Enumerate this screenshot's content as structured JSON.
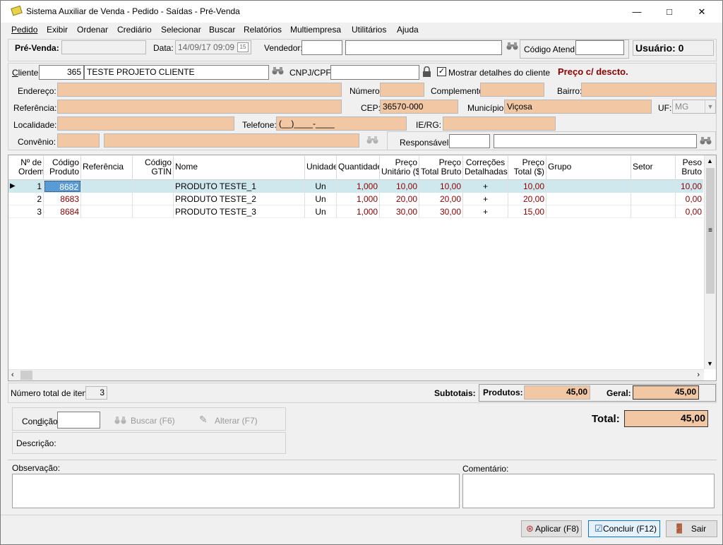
{
  "window": {
    "title": "Sistema Auxiliar de Venda - Pedido - Saídas - Pré-Venda",
    "minimize": "—",
    "maximize": "□",
    "close": "✕"
  },
  "menu": [
    "Pedido",
    "Exibir",
    "Ordenar",
    "Crediário",
    "Selecionar",
    "Buscar",
    "Relatórios",
    "Multiempresa",
    "Utilitários",
    "Ajuda"
  ],
  "header": {
    "prevenda_label": "Pré-Venda:",
    "prevenda_value": "",
    "data_label": "Data:",
    "data_value": "14/09/17 09:09",
    "vendedor_label": "Vendedor:",
    "vendedor_code": "",
    "vendedor_name": "",
    "codigo_atend_label": "Código Atend.:",
    "codigo_atend_value": "",
    "usuario": "Usuário: 0"
  },
  "cliente": {
    "label": "Cliente:",
    "code": "365",
    "name": "TESTE PROJETO CLIENTE",
    "cnpj_label": "CNPJ/CPF:",
    "cnpj_value": "",
    "mostrar_label": "Mostrar detalhes do cliente",
    "mostrar_checked": true,
    "preco_label": "Preço c/ descto.",
    "endereco_label": "Endereço:",
    "endereco": "",
    "numero_label": "Número:",
    "numero": "",
    "complemento_label": "Complemento:",
    "complemento": "",
    "bairro_label": "Bairro:",
    "bairro": "",
    "referencia_label": "Referência:",
    "referencia": "",
    "cep_label": "CEP:",
    "cep": "36570-000",
    "municipio_label": "Município:",
    "municipio": "Viçosa",
    "uf_label": "UF:",
    "uf": "MG",
    "localidade_label": "Localidade:",
    "localidade": "",
    "telefone_label": "Telefone:",
    "telefone": "(__)____-____",
    "iers_label": "IE/RG:",
    "iers": "",
    "convenio_label": "Convênio:",
    "convenio_code": "",
    "convenio_name": "",
    "responsavel_label": "Responsável:",
    "responsavel_code": "",
    "responsavel_name": ""
  },
  "grid": {
    "columns": [
      {
        "line1": "Nº de",
        "line2": "Ordem"
      },
      {
        "line1": "Código",
        "line2": "Produto"
      },
      {
        "line1": "Referência",
        "line2": ""
      },
      {
        "line1": "Código",
        "line2": "GTIN"
      },
      {
        "line1": "Nome",
        "line2": ""
      },
      {
        "line1": "Unidade",
        "line2": ""
      },
      {
        "line1": "Quantidade",
        "line2": ""
      },
      {
        "line1": "Preço",
        "line2": "Unitário ($)"
      },
      {
        "line1": "Preço",
        "line2": "Total Bruto ($)"
      },
      {
        "line1": "Correções",
        "line2": "Detalhadas"
      },
      {
        "line1": "Preço",
        "line2": "Total ($)"
      },
      {
        "line1": "Grupo",
        "line2": ""
      },
      {
        "line1": "Setor",
        "line2": ""
      },
      {
        "line1": "Peso",
        "line2": "Bruto"
      }
    ],
    "rows": [
      {
        "ordem": "1",
        "codigo": "8682",
        "referencia": "",
        "gtin": "",
        "nome": "PRODUTO TESTE_1",
        "unidade": "Un",
        "quantidade": "1,000",
        "preco_unit": "10,00",
        "total_bruto": "10,00",
        "correcoes": "+",
        "total": "10,00",
        "grupo": "",
        "setor": "",
        "peso": "10,00"
      },
      {
        "ordem": "2",
        "codigo": "8683",
        "referencia": "",
        "gtin": "",
        "nome": "PRODUTO TESTE_2",
        "unidade": "Un",
        "quantidade": "1,000",
        "preco_unit": "20,00",
        "total_bruto": "20,00",
        "correcoes": "+",
        "total": "20,00",
        "grupo": "",
        "setor": "",
        "peso": "0,00"
      },
      {
        "ordem": "3",
        "codigo": "8684",
        "referencia": "",
        "gtin": "",
        "nome": "PRODUTO TESTE_3",
        "unidade": "Un",
        "quantidade": "1,000",
        "preco_unit": "30,00",
        "total_bruto": "30,00",
        "correcoes": "+",
        "total": "15,00",
        "grupo": "",
        "setor": "",
        "peso": "0,00"
      }
    ]
  },
  "footer": {
    "num_itens_label": "Número total de itens:",
    "num_itens": "3",
    "subtotais_label": "Subtotais:",
    "produtos_label": "Produtos:",
    "produtos": "45,00",
    "geral_label": "Geral:",
    "geral": "45,00",
    "condicao_label": "Condição:",
    "condicao": "",
    "buscar_label": "Buscar (F6)",
    "alterar_label": "Alterar (F7)",
    "descricao_label": "Descrição:",
    "total_label": "Total:",
    "total": "45,00",
    "observacao_label": "Observação:",
    "comentario_label": "Comentário:",
    "aplicar_label": "Aplicar (F8)",
    "concluir_label": "Concluir (F12)",
    "sair_label": "Sair"
  },
  "colors": {
    "salmon": "#f2c8a4",
    "selected_row": "#cfe8ee",
    "accent_red": "#8b0000"
  }
}
